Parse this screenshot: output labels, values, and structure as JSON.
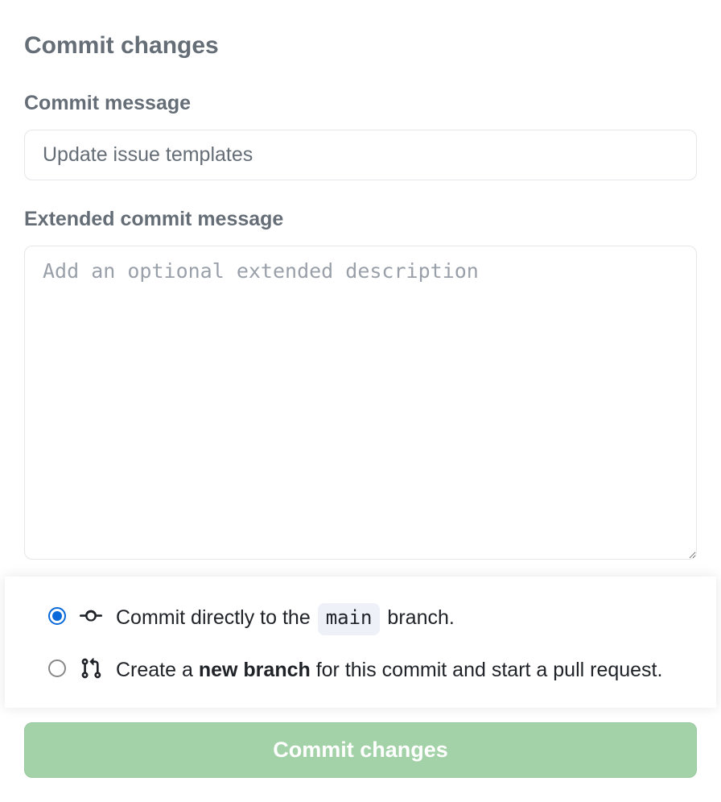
{
  "heading": "Commit changes",
  "commit_message": {
    "label": "Commit message",
    "value": "Update issue templates"
  },
  "extended_message": {
    "label": "Extended commit message",
    "placeholder": "Add an optional extended description"
  },
  "options": {
    "direct": {
      "prefix": "Commit directly to the ",
      "branch": "main",
      "suffix": " branch.",
      "selected": true
    },
    "new_branch": {
      "prefix": "Create a ",
      "bold": "new branch",
      "suffix": " for this commit and start a pull request.",
      "selected": false
    }
  },
  "submit_label": "Commit changes"
}
